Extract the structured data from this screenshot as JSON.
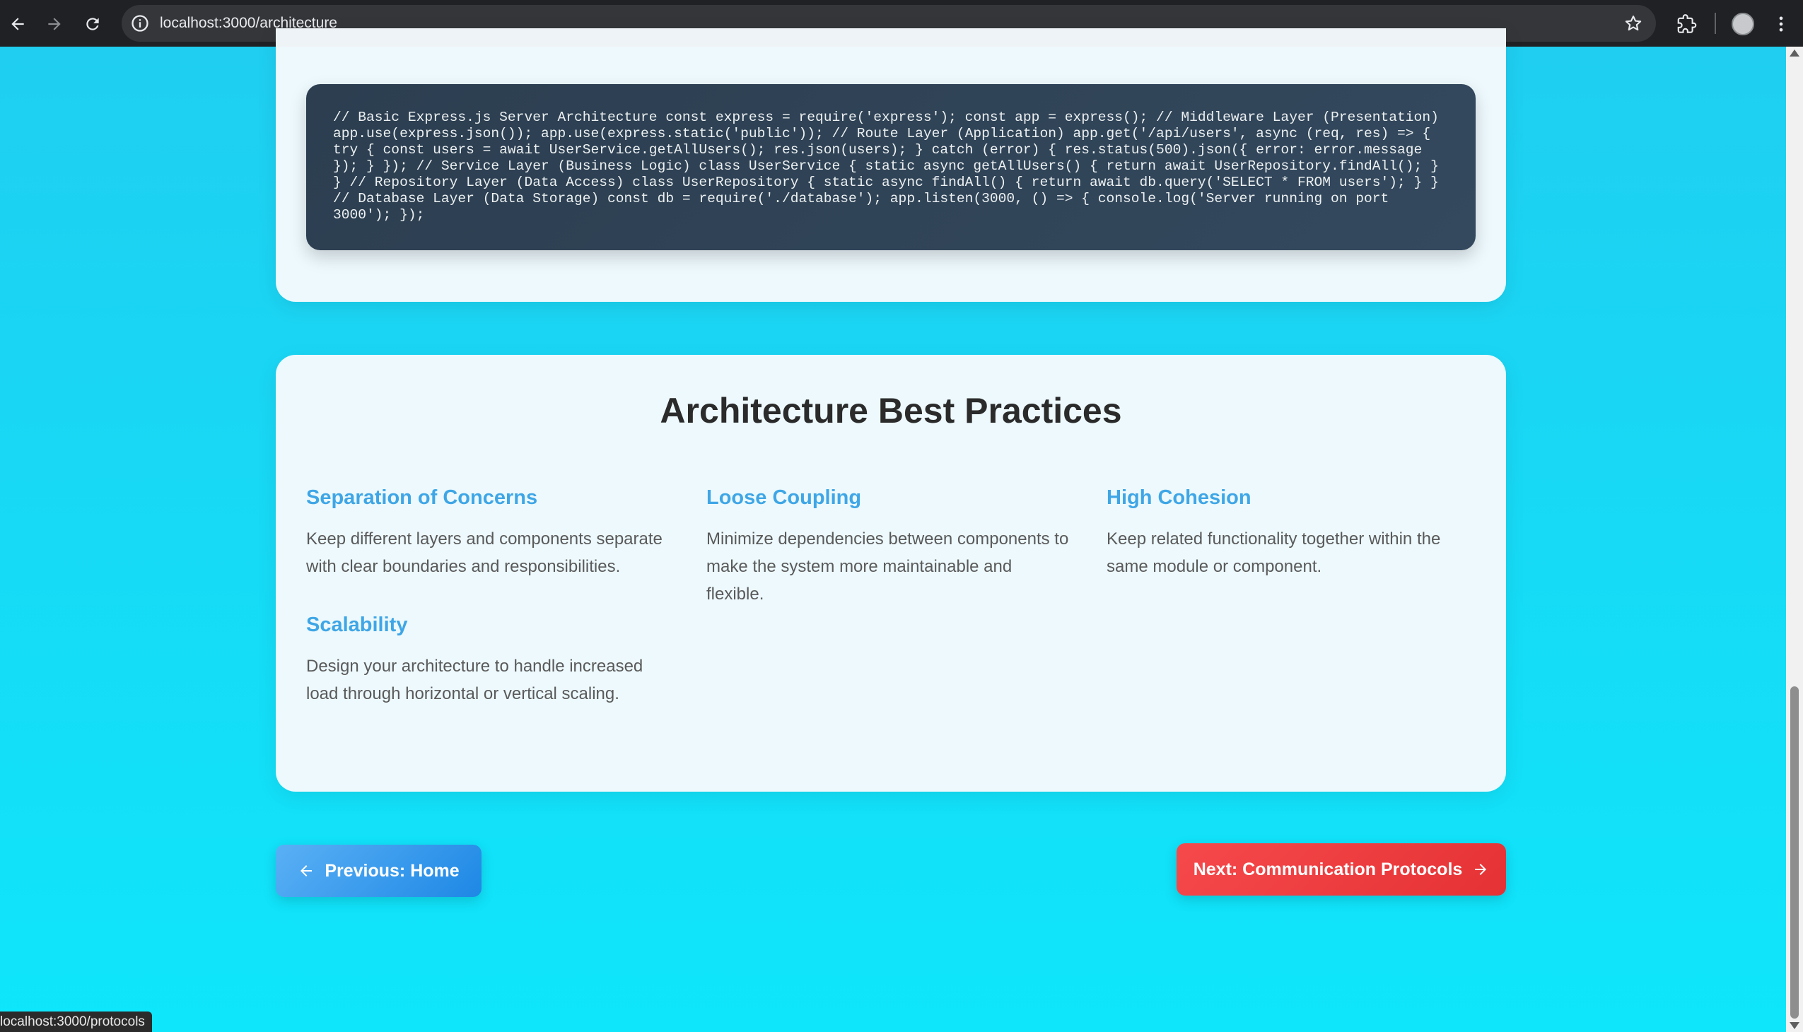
{
  "browser": {
    "url": "localhost:3000/architecture",
    "status_url": "localhost:3000/protocols"
  },
  "code_card": {
    "code": "// Basic Express.js Server Architecture const express = require('express'); const app = express(); // Middleware Layer (Presentation) app.use(express.json()); app.use(express.static('public')); // Route Layer (Application) app.get('/api/users', async (req, res) => { try { const users = await UserService.getAllUsers(); res.json(users); } catch (error) { res.status(500).json({ error: error.message }); } }); // Service Layer (Business Logic) class UserService { static async getAllUsers() { return await UserRepository.findAll(); } } // Repository Layer (Data Access) class UserRepository { static async findAll() { return await db.query('SELECT * FROM users'); } } // Database Layer (Data Storage) const db = require('./database'); app.listen(3000, () => { console.log('Server running on port 3000'); });"
  },
  "best_practices": {
    "title": "Architecture Best Practices",
    "items": [
      {
        "title": "Separation of Concerns",
        "text": "Keep different layers and components separate with clear boundaries and responsibilities."
      },
      {
        "title": "Loose Coupling",
        "text": "Minimize dependencies between components to make the system more maintainable and flexible."
      },
      {
        "title": "High Cohesion",
        "text": "Keep related functionality together within the same module or component."
      },
      {
        "title": "Scalability",
        "text": "Design your architecture to handle increased load through horizontal or vertical scaling."
      }
    ]
  },
  "navigation": {
    "prev_label": "Previous: Home",
    "next_label": "Next: Communication Protocols"
  },
  "colors": {
    "background": "#1ad8f6",
    "accent_blue": "#3fa6e6",
    "next_button": "#e53234",
    "code_bg": "#2c3e50"
  },
  "icons": {
    "back": "back-arrow-icon",
    "forward": "forward-arrow-icon",
    "reload": "reload-icon",
    "info": "info-icon",
    "bookmark": "star-icon",
    "extensions": "puzzle-icon",
    "menu": "kebab-menu-icon",
    "prev": "arrow-left-icon",
    "next": "arrow-right-icon"
  }
}
